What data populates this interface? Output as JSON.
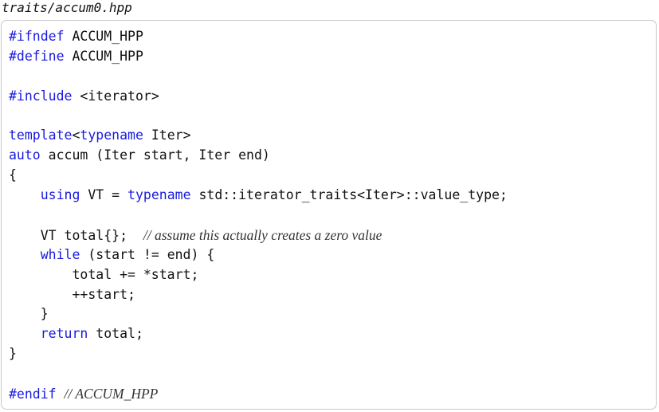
{
  "file_title": "traits/accum0.hpp",
  "colors": {
    "keyword": "#1a1ae0",
    "text": "#111111",
    "comment": "#333333",
    "border": "#c8c8c8"
  },
  "code_lines": [
    [
      {
        "t": "#ifndef",
        "k": "kw"
      },
      {
        "t": " ACCUM_HPP"
      }
    ],
    [
      {
        "t": "#define",
        "k": "kw"
      },
      {
        "t": " ACCUM_HPP"
      }
    ],
    [],
    [
      {
        "t": "#include",
        "k": "kw"
      },
      {
        "t": " <iterator>"
      }
    ],
    [],
    [
      {
        "t": "template",
        "k": "kw"
      },
      {
        "t": "<"
      },
      {
        "t": "typename",
        "k": "kw"
      },
      {
        "t": " Iter>"
      }
    ],
    [
      {
        "t": "auto",
        "k": "kw"
      },
      {
        "t": " accum (Iter start, Iter end)"
      }
    ],
    [
      {
        "t": "{"
      }
    ],
    [
      {
        "t": "    "
      },
      {
        "t": "using",
        "k": "kw"
      },
      {
        "t": " VT = "
      },
      {
        "t": "typename",
        "k": "kw"
      },
      {
        "t": " std::iterator_traits<Iter>::value_type;"
      }
    ],
    [],
    [
      {
        "t": "    VT total{};  "
      },
      {
        "t": "// assume this actually creates a zero value",
        "k": "cm"
      }
    ],
    [
      {
        "t": "    "
      },
      {
        "t": "while",
        "k": "kw"
      },
      {
        "t": " (start != end) {"
      }
    ],
    [
      {
        "t": "        total += *start;"
      }
    ],
    [
      {
        "t": "        ++start;"
      }
    ],
    [
      {
        "t": "    }"
      }
    ],
    [
      {
        "t": "    "
      },
      {
        "t": "return",
        "k": "kw"
      },
      {
        "t": " total;"
      }
    ],
    [
      {
        "t": "}"
      }
    ],
    [],
    [
      {
        "t": "#endif",
        "k": "kw"
      },
      {
        "t": " "
      },
      {
        "t": "// ACCUM_HPP",
        "k": "cm"
      }
    ]
  ]
}
